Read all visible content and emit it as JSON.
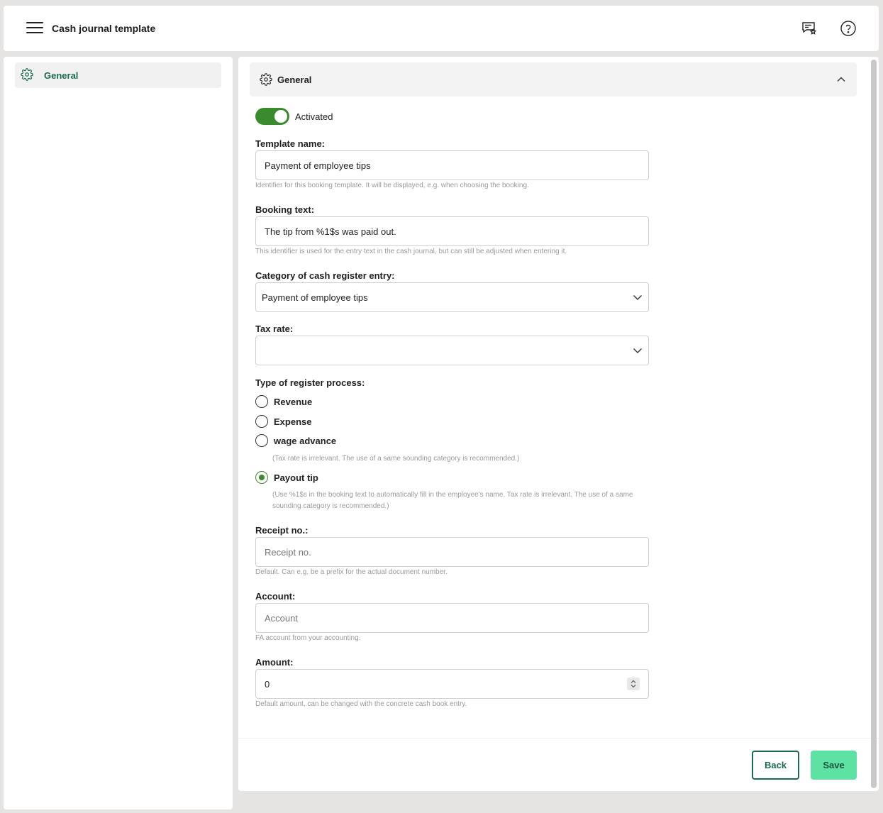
{
  "header": {
    "title": "Cash journal template",
    "menu_icon": "hamburger-menu-icon",
    "feedback_icon": "feedback-star-icon",
    "help_icon": "help-circle-icon"
  },
  "sidebar": {
    "items": [
      {
        "label": "General",
        "icon": "gear-icon",
        "active": true
      }
    ]
  },
  "section": {
    "title": "General",
    "icon": "gear-icon",
    "expanded": true
  },
  "form": {
    "activated": {
      "label": "Activated",
      "on": true
    },
    "template_name": {
      "label": "Template name:",
      "value": "Payment of employee tips",
      "hint": "Identifier for this booking template. It will be displayed, e.g. when choosing the booking."
    },
    "booking_text": {
      "label": "Booking text:",
      "value": "The tip from %1$s was paid out.",
      "hint": "This identifier is used for the entry text in the cash journal, but can still be adjusted when entering it."
    },
    "category": {
      "label": "Category of cash register entry:",
      "value": "Payment of employee tips"
    },
    "tax_rate": {
      "label": "Tax rate:",
      "value": ""
    },
    "process_type": {
      "label": "Type of register process:",
      "options": [
        {
          "label": "Revenue",
          "checked": false,
          "hint": ""
        },
        {
          "label": "Expense",
          "checked": false,
          "hint": ""
        },
        {
          "label": "wage advance",
          "checked": false,
          "hint": "(Tax rate is irrelevant. The use of a same sounding category is recommended.)"
        },
        {
          "label": "Payout tip",
          "checked": true,
          "hint": "(Use %1$s in the booking text to automatically fill in the employee's name. Tax rate is irrelevant. The use of a same sounding category is recommended.)"
        }
      ]
    },
    "receipt_no": {
      "label": "Receipt no.:",
      "placeholder": "Receipt no.",
      "hint": "Default. Can e.g. be a prefix for the actual document number."
    },
    "account": {
      "label": "Account:",
      "placeholder": "Account",
      "hint": "FA account from your accounting."
    },
    "amount": {
      "label": "Amount:",
      "value": "0",
      "hint": "Default amount, can be changed with the concrete cash book entry."
    }
  },
  "footer": {
    "back_label": "Back",
    "save_label": "Save"
  },
  "colors": {
    "accent_green": "#3c8a2e",
    "brand_dark_green": "#1b6b4f",
    "save_button_bg": "#5de2a3"
  }
}
